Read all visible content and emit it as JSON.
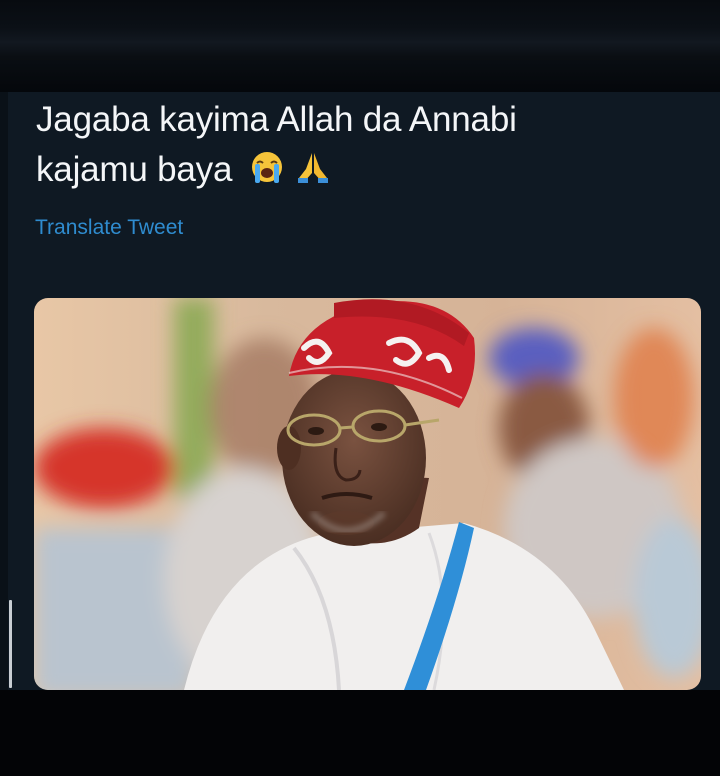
{
  "tweet": {
    "text_line1": "Jagaba kayima Allah da Annabi",
    "text_line2": "kajamu baya",
    "emojis": [
      "crying-face",
      "folded-hands"
    ],
    "translate_label": "Translate Tweet"
  },
  "media": {
    "subject": "photo",
    "colors": {
      "cap_red": "#c8202a",
      "robe_white": "#f1efee",
      "sash_blue": "#2f8fd8",
      "link_blue": "#2f8ccf",
      "card_bg": "#0f1923"
    }
  }
}
